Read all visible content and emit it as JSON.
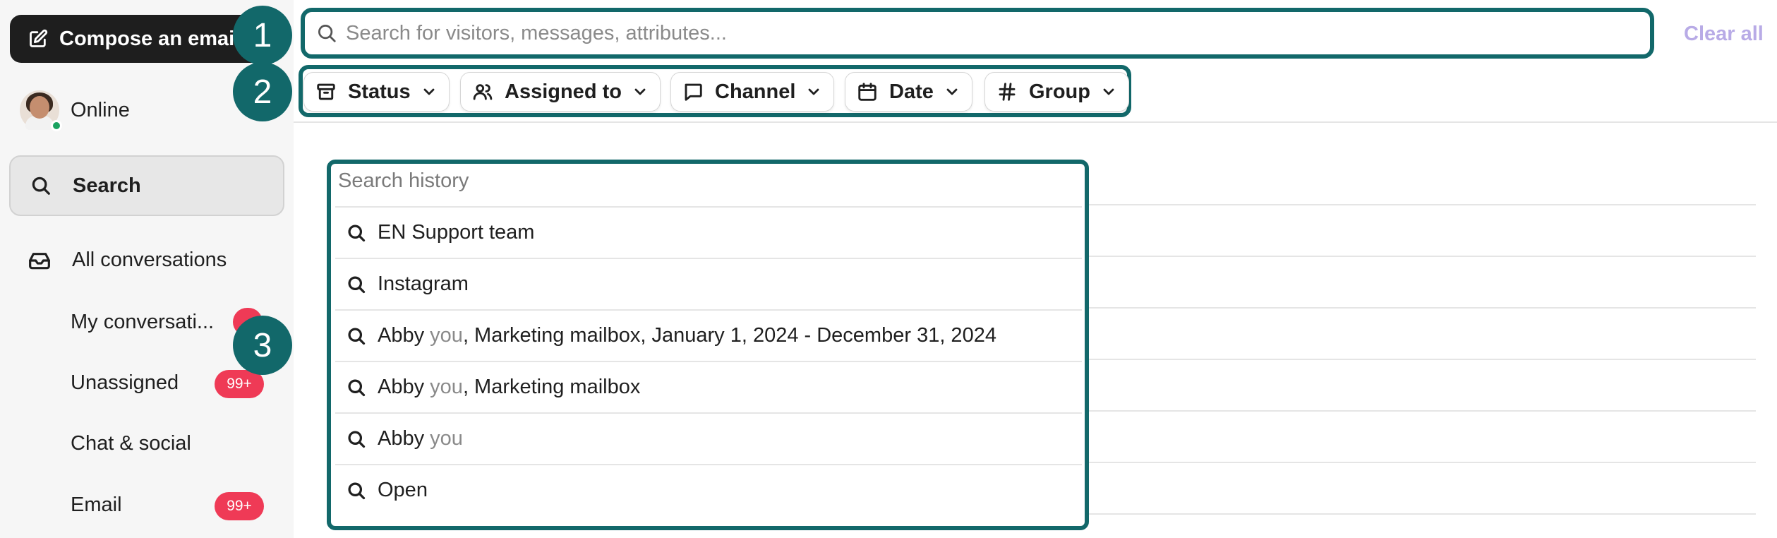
{
  "sidebar": {
    "compose_label": "Compose an email",
    "status_label": "Online",
    "search_label": "Search",
    "all_conversations_label": "All conversations",
    "items": [
      {
        "label": "My conversati...",
        "badge": ""
      },
      {
        "label": "Unassigned",
        "badge": "99+"
      },
      {
        "label": "Chat & social",
        "badge": ""
      },
      {
        "label": "Email",
        "badge": "99+"
      }
    ]
  },
  "search": {
    "placeholder": "Search for visitors, messages, attributes...",
    "value": "",
    "clear_label": "Clear all"
  },
  "filters": [
    {
      "label": "Status",
      "icon": "archive-icon"
    },
    {
      "label": "Assigned to",
      "icon": "users-icon"
    },
    {
      "label": "Channel",
      "icon": "chat-bubble-icon"
    },
    {
      "label": "Date",
      "icon": "calendar-icon"
    },
    {
      "label": "Group",
      "icon": "hash-icon"
    }
  ],
  "history": {
    "title": "Search history",
    "items": [
      {
        "prefix": "EN Support team",
        "muted": "",
        "suffix": ""
      },
      {
        "prefix": "Instagram",
        "muted": "",
        "suffix": ""
      },
      {
        "prefix": "Abby ",
        "muted": "you",
        "suffix": ", Marketing mailbox, January 1, 2024 - December 31, 2024"
      },
      {
        "prefix": "Abby ",
        "muted": "you",
        "suffix": ", Marketing mailbox"
      },
      {
        "prefix": "Abby ",
        "muted": "you",
        "suffix": ""
      },
      {
        "prefix": "Open",
        "muted": "",
        "suffix": ""
      }
    ]
  },
  "callouts": [
    "1",
    "2",
    "3"
  ],
  "colors": {
    "accent": "#12686a",
    "badge": "#ef3a56",
    "clear_all": "#b8abe6",
    "online": "#1aa260"
  }
}
